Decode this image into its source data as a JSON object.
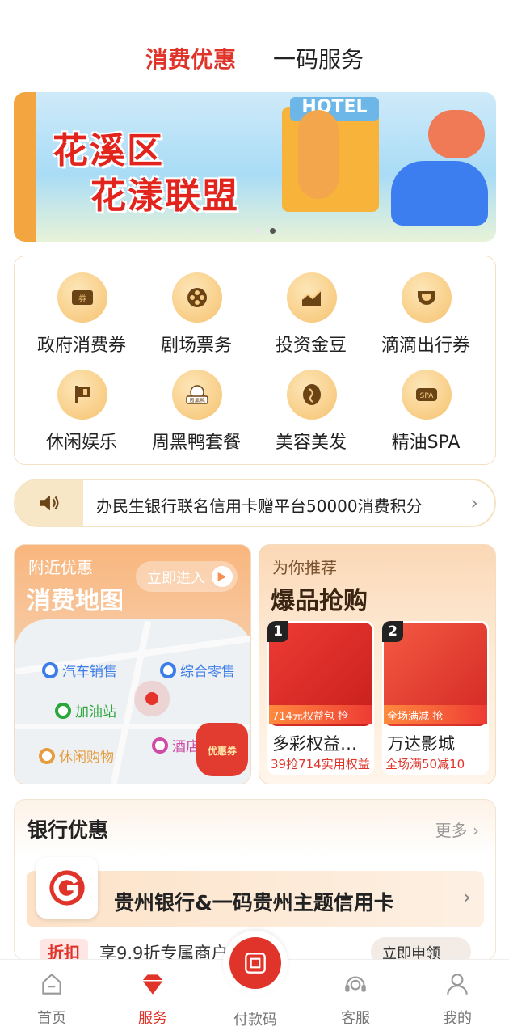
{
  "top_tabs": {
    "active": "消费优惠",
    "inactive": "一码服务"
  },
  "banner": {
    "line1": "花溪区",
    "line2": "花漾联盟",
    "hotel_sign": "HOTEL",
    "page_count": 2,
    "current_page": 2
  },
  "services": [
    {
      "label": "政府消费券",
      "icon": "ticket-icon"
    },
    {
      "label": "剧场票务",
      "icon": "film-reel-icon"
    },
    {
      "label": "投资金豆",
      "icon": "chart-icon"
    },
    {
      "label": "滴滴出行券",
      "icon": "didi-icon"
    },
    {
      "label": "休闲娱乐",
      "icon": "flag-icon"
    },
    {
      "label": "周黑鸭套餐",
      "icon": "zhouheiya-icon"
    },
    {
      "label": "美容美发",
      "icon": "face-icon"
    },
    {
      "label": "精油SPA",
      "icon": "spa-icon"
    }
  ],
  "services_icon_text": {
    "ticket": "券",
    "spa": "SPA",
    "zhouheiya": "周黑鸭"
  },
  "notice": {
    "text": "办民生银行联名信用卡赠平台50000消费积分"
  },
  "map_card": {
    "subtitle": "附近优惠",
    "title": "消费地图",
    "enter_label": "立即进入",
    "pois": {
      "car": "汽车销售",
      "retail": "综合零售",
      "gas": "加油站",
      "leisure": "休闲购物",
      "hotel": "酒店"
    },
    "coupon_label": "优惠券"
  },
  "rec_card": {
    "subtitle": "为你推荐",
    "title": "爆品抢购",
    "items": [
      {
        "rank": "1",
        "tag": "714元权益包",
        "name": "多彩权益…",
        "desc": "39抢714实用权益"
      },
      {
        "rank": "2",
        "tag": "全场满减",
        "name": "万达影城",
        "desc": "全场满50减10"
      }
    ],
    "grab": "抢"
  },
  "bank": {
    "title": "银行优惠",
    "more": "更多",
    "row_text": "贵州银行&一码贵州主题信用卡",
    "badge": "折扣",
    "bottom_text": "享9.9折专属商户优惠",
    "apply": "立即申领"
  },
  "bottom_nav": {
    "home": "首页",
    "service": "服务",
    "pay": "付款码",
    "support": "客服",
    "mine": "我的"
  },
  "colors": {
    "accent": "#e0342b",
    "gold": "#f8cd85"
  }
}
